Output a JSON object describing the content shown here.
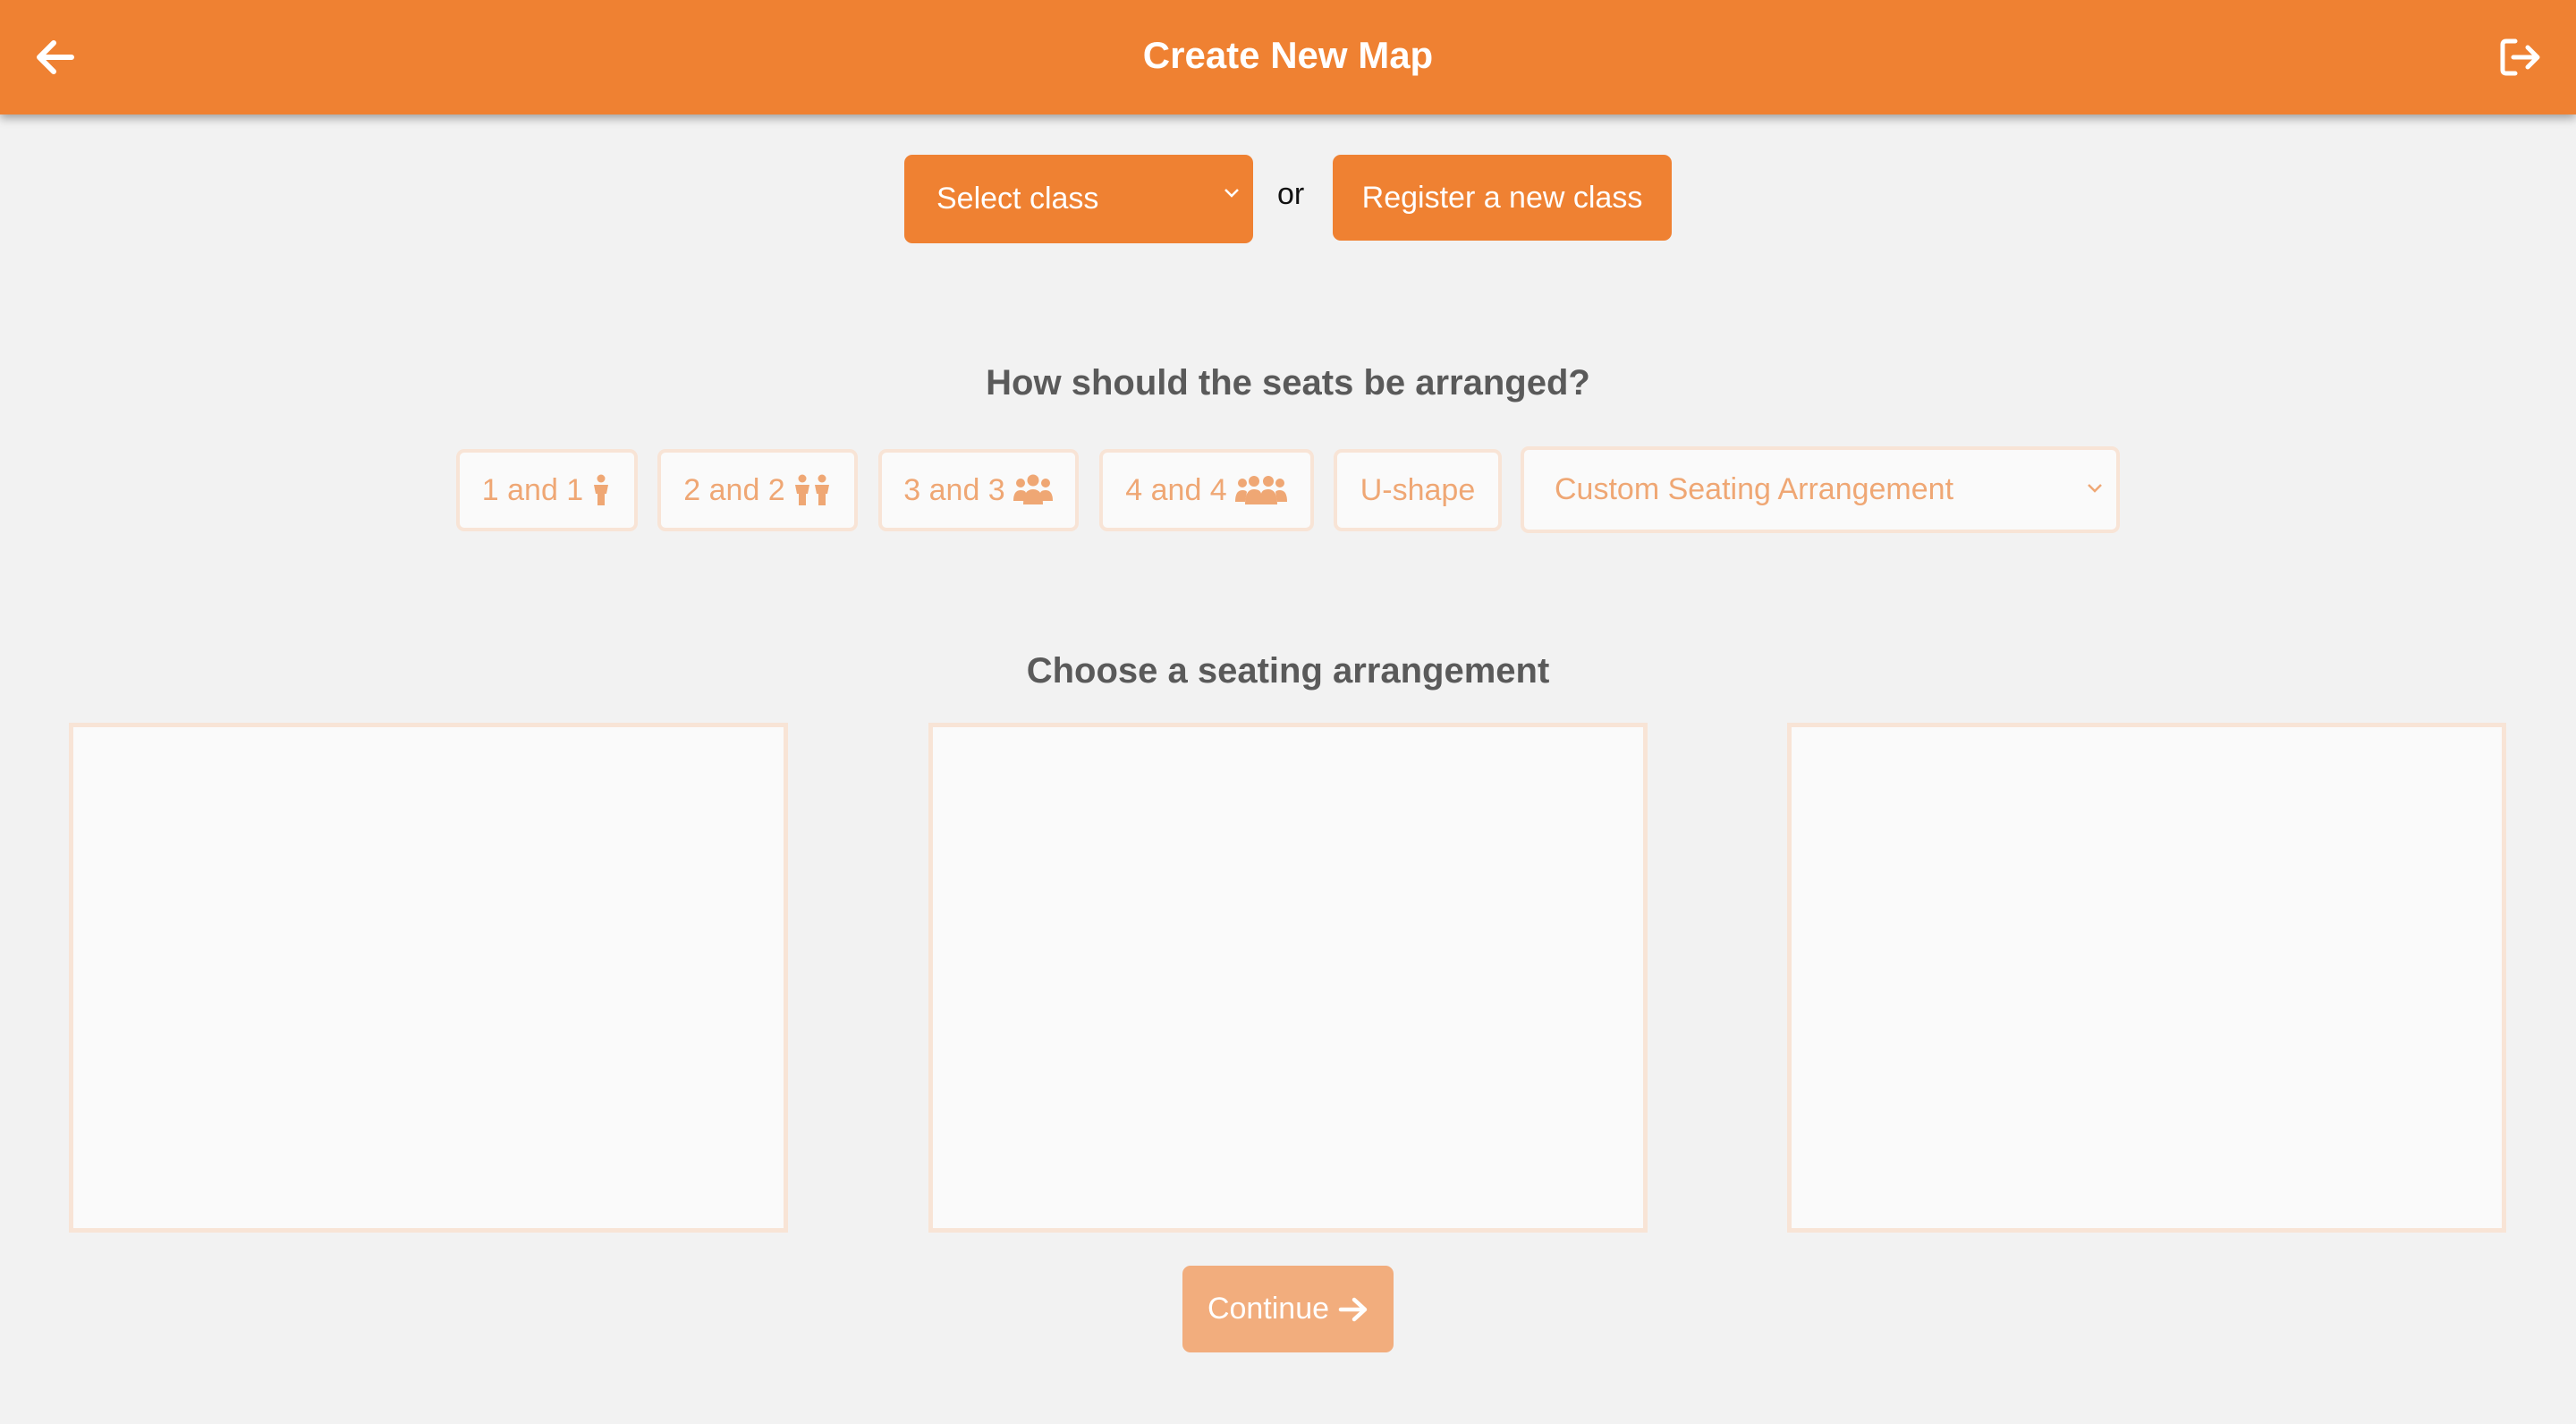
{
  "header": {
    "title": "Create New Map",
    "back_icon": "arrow-left-icon",
    "logout_icon": "sign-out-icon",
    "bg_color": "#ef8132"
  },
  "class_row": {
    "select_value": "Select class",
    "or_label": "or",
    "register_label": "Register a new class"
  },
  "seating": {
    "question": "How should the seats be arranged?",
    "options": [
      {
        "label": "1 and 1",
        "icon": "person-icon"
      },
      {
        "label": "2 and 2",
        "icon": "two-people-icon"
      },
      {
        "label": "3 and 3",
        "icon": "three-people-icon"
      },
      {
        "label": "4 and 4",
        "icon": "four-people-icon"
      },
      {
        "label": "U-shape"
      }
    ],
    "custom_select_value": "Custom Seating Arrangement"
  },
  "arrangement": {
    "heading": "Choose a seating arrangement",
    "card_count": 3
  },
  "footer": {
    "continue_label": "Continue",
    "continue_icon": "arrow-right-icon"
  },
  "colors": {
    "accent": "#ef8132",
    "accent_light": "#efa774",
    "border_light": "#f8e4d6",
    "continue_disabled": "#f2ad7d"
  }
}
